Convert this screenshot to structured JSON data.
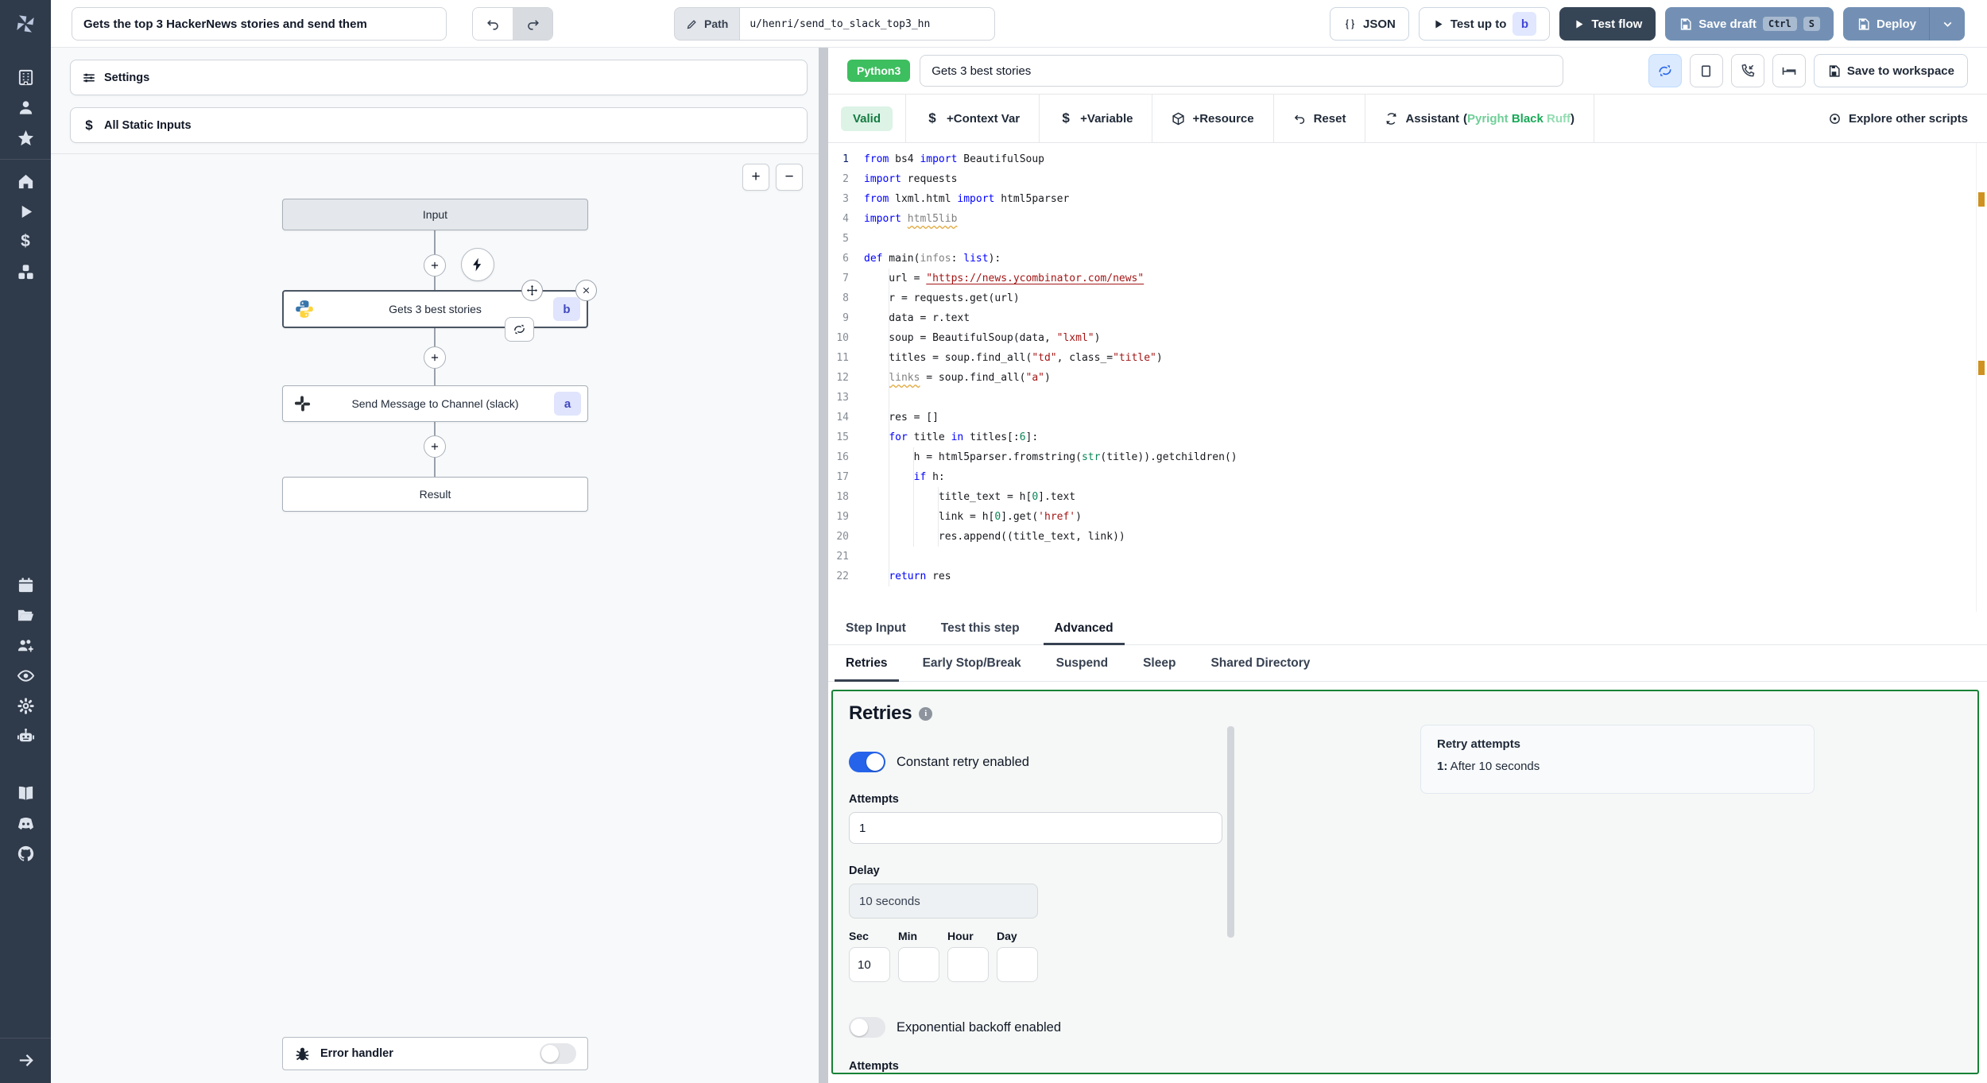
{
  "topbar": {
    "title_value": "Gets the top 3 HackerNews stories and send them",
    "path_label": "Path",
    "path_value": "u/henri/send_to_slack_top3_hn",
    "json_button": "JSON",
    "test_up_to": "Test up to",
    "test_up_to_badge": "b",
    "test_flow": "Test flow",
    "save_draft": "Save draft",
    "kbd_ctrl": "Ctrl",
    "kbd_s": "S",
    "deploy": "Deploy"
  },
  "sidebar": {
    "icons": [
      "workspace",
      "user",
      "favorites",
      "home",
      "runs",
      "variables",
      "resources",
      "schedules",
      "folders",
      "groups",
      "audit-logs",
      "settings",
      "workers",
      "docs",
      "discord",
      "github",
      "collapse"
    ]
  },
  "flow": {
    "settings_label": "Settings",
    "static_inputs_label": "All Static Inputs",
    "zoom_in": "+",
    "zoom_out": "−",
    "input_label": "Input",
    "step_b_label": "Gets 3 best stories",
    "step_b_badge": "b",
    "step_a_label": "Send Message to Channel (slack)",
    "step_a_badge": "a",
    "result_label": "Result",
    "error_handler_label": "Error handler"
  },
  "step": {
    "lang_badge": "Python3",
    "name_value": "Gets 3 best stories",
    "save_to_workspace": "Save to workspace",
    "toolbar": {
      "valid": "Valid",
      "context_var": "+Context Var",
      "variable": "+Variable",
      "resource": "+Resource",
      "reset": "Reset",
      "assistant": "Assistant",
      "assistant_open": "(",
      "assistant_pyright": "Pyright",
      "assistant_black": "Black",
      "assistant_ruff": "Ruff",
      "assistant_close": ")",
      "explore": "Explore other scripts"
    }
  },
  "editor": {
    "lines": [
      [
        [
          "kw",
          "from"
        ],
        [
          "pl",
          " bs4 "
        ],
        [
          "kw",
          "import"
        ],
        [
          "pl",
          " BeautifulSoup"
        ]
      ],
      [
        [
          "kw",
          "import"
        ],
        [
          "pl",
          " requests"
        ]
      ],
      [
        [
          "kw",
          "from"
        ],
        [
          "pl",
          " lxml.html "
        ],
        [
          "kw",
          "import"
        ],
        [
          "pl",
          " html5parser"
        ]
      ],
      [
        [
          "kw",
          "import"
        ],
        [
          "pl",
          " "
        ],
        [
          "un",
          "html5lib"
        ]
      ],
      [],
      [
        [
          "kw",
          "def"
        ],
        [
          "pl",
          " main("
        ],
        [
          "param",
          "infos"
        ],
        [
          "pl",
          ": "
        ],
        [
          "kw",
          "list"
        ],
        [
          "pl",
          "):"
        ]
      ],
      [
        [
          "pl",
          "    url = "
        ],
        [
          "link",
          "\"https://news.ycombinator.com/news\""
        ]
      ],
      [
        [
          "pl",
          "    r = requests.get(url)"
        ]
      ],
      [
        [
          "pl",
          "    data = r.text"
        ]
      ],
      [
        [
          "pl",
          "    soup = BeautifulSoup(data, "
        ],
        [
          "str",
          "\"lxml\""
        ],
        [
          "pl",
          ")"
        ]
      ],
      [
        [
          "pl",
          "    titles = soup.find_all("
        ],
        [
          "str",
          "\"td\""
        ],
        [
          "pl",
          ", class_="
        ],
        [
          "str",
          "\"title\""
        ],
        [
          "pl",
          ")"
        ]
      ],
      [
        [
          "pl",
          "    "
        ],
        [
          "un",
          "links"
        ],
        [
          "pl",
          " = soup.find_all("
        ],
        [
          "str",
          "\"a\""
        ],
        [
          "pl",
          ")"
        ]
      ],
      [],
      [
        [
          "pl",
          "    res = []"
        ]
      ],
      [
        [
          "pl",
          "    "
        ],
        [
          "kw",
          "for"
        ],
        [
          "pl",
          " title "
        ],
        [
          "kw",
          "in"
        ],
        [
          "pl",
          " titles[:"
        ],
        [
          "num",
          "6"
        ],
        [
          "pl",
          "]:"
        ]
      ],
      [
        [
          "pl",
          "        h = html5parser.fromstring("
        ],
        [
          "ty",
          "str"
        ],
        [
          "pl",
          "(title)).getchildren()"
        ]
      ],
      [
        [
          "pl",
          "        "
        ],
        [
          "kw",
          "if"
        ],
        [
          "pl",
          " h:"
        ]
      ],
      [
        [
          "pl",
          "            title_text = h["
        ],
        [
          "num",
          "0"
        ],
        [
          "pl",
          "].text"
        ]
      ],
      [
        [
          "pl",
          "            link = h["
        ],
        [
          "num",
          "0"
        ],
        [
          "pl",
          "].get("
        ],
        [
          "str",
          "'href'"
        ],
        [
          "pl",
          ")"
        ]
      ],
      [
        [
          "pl",
          "            res.append((title_text, link))"
        ]
      ],
      [],
      [
        [
          "pl",
          "    "
        ],
        [
          "kw",
          "return"
        ],
        [
          "pl",
          " res"
        ]
      ]
    ]
  },
  "tabs": {
    "primary": [
      "Step Input",
      "Test this step",
      "Advanced"
    ],
    "secondary": [
      "Retries",
      "Early Stop/Break",
      "Suspend",
      "Sleep",
      "Shared Directory"
    ]
  },
  "retries": {
    "heading": "Retries",
    "constant_toggle_label": "Constant retry enabled",
    "attempts_label": "Attempts",
    "attempts_value": "1",
    "delay_label": "Delay",
    "delay_value": "10 seconds",
    "units": [
      "Sec",
      "Min",
      "Hour",
      "Day"
    ],
    "unit_values": [
      "10",
      "",
      "",
      ""
    ],
    "exponential_toggle_label": "Exponential backoff enabled",
    "attempts2_label": "Attempts",
    "summary_title": "Retry attempts",
    "summary_item_prefix": "1:",
    "summary_item_text": " After 10 seconds"
  },
  "colors": {
    "accent_green": "#3dbe5f",
    "panel_border_green": "#178236",
    "toggle_on_blue": "#2563eb",
    "badge_indigo_bg": "#e0e4fc",
    "badge_indigo_text": "#4049c0",
    "sidebar_bg": "#2f3a4a",
    "steel_button": "#7390b4",
    "warning_marker": "#cf9220"
  }
}
